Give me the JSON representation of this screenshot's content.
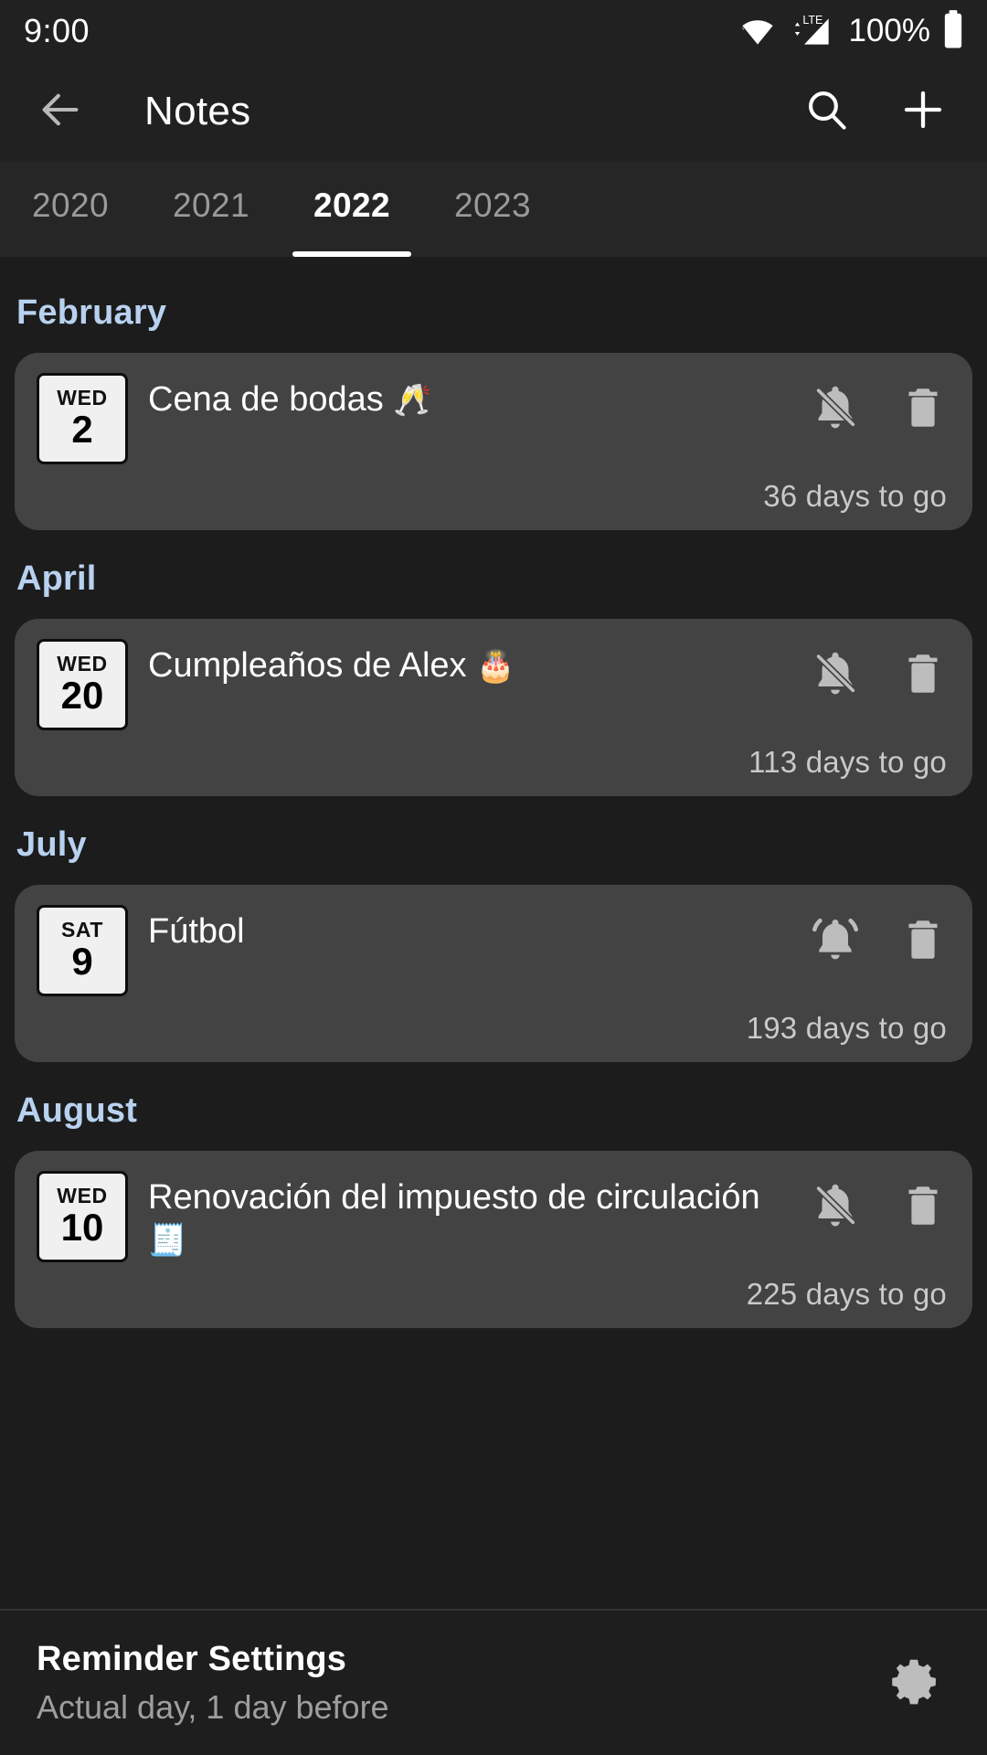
{
  "status_bar": {
    "time": "9:00",
    "network_type": "LTE",
    "battery_percent": "100%",
    "wifi_icon": "wifi-icon",
    "signal_icon": "cell-signal-icon",
    "battery_icon": "battery-full-icon"
  },
  "app_bar": {
    "back_icon": "back-arrow-icon",
    "title": "Notes",
    "search_icon": "search-icon",
    "add_icon": "plus-icon"
  },
  "tabs": {
    "items": [
      {
        "label": "2020",
        "active": false
      },
      {
        "label": "2021",
        "active": false
      },
      {
        "label": "2022",
        "active": true
      },
      {
        "label": "2023",
        "active": false
      }
    ]
  },
  "accent_colors": {
    "month_header": "#b8d1ef",
    "card_background": "#434343",
    "page_background": "#1c1c1c",
    "tab_indicator": "#ffffff"
  },
  "groups": [
    {
      "month": "February",
      "events": [
        {
          "day_of_week": "WED",
          "day_number": "2",
          "title": "Cena de bodas",
          "emoji": "🥂",
          "reminder_icon": "bell-off-icon",
          "reminder_muted": true,
          "delete_icon": "trash-icon",
          "days_to_go": "36 days to go"
        }
      ]
    },
    {
      "month": "April",
      "events": [
        {
          "day_of_week": "WED",
          "day_number": "20",
          "title": "Cumpleaños de Alex",
          "emoji": "🎂",
          "reminder_icon": "bell-off-icon",
          "reminder_muted": true,
          "delete_icon": "trash-icon",
          "days_to_go": "113 days to go"
        }
      ]
    },
    {
      "month": "July",
      "events": [
        {
          "day_of_week": "SAT",
          "day_number": "9",
          "title": "Fútbol",
          "emoji": "",
          "reminder_icon": "bell-ringing-icon",
          "reminder_muted": false,
          "delete_icon": "trash-icon",
          "days_to_go": "193 days to go"
        }
      ]
    },
    {
      "month": "August",
      "events": [
        {
          "day_of_week": "WED",
          "day_number": "10",
          "title": "Renovación del impuesto de circulación",
          "emoji": "🧾",
          "reminder_icon": "bell-off-icon",
          "reminder_muted": true,
          "delete_icon": "trash-icon",
          "days_to_go": "225 days to go"
        }
      ]
    }
  ],
  "bottom_bar": {
    "title": "Reminder Settings",
    "subtitle": "Actual day, 1 day before",
    "gear_icon": "gear-icon"
  }
}
